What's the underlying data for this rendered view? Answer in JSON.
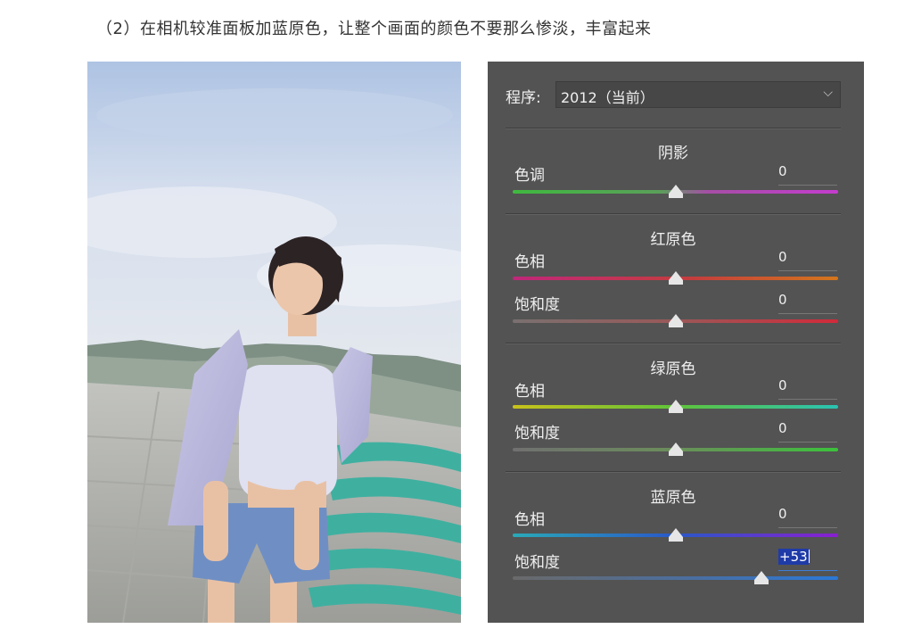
{
  "instruction": "（2）在相机较准面板加蓝原色，让整个画面的颜色不要那么惨淡，丰富起来",
  "colors": {
    "panel_bg": "#535353",
    "highlight": "#1f3ba8"
  },
  "panel": {
    "process_label": "程序:",
    "process_value": "2012（当前）",
    "sections": {
      "shadows": {
        "title": "阴影",
        "tint": {
          "label": "色调",
          "value": "0",
          "slider_fraction": 0.5
        }
      },
      "red": {
        "title": "红原色",
        "hue": {
          "label": "色相",
          "value": "0",
          "slider_fraction": 0.5
        },
        "saturation": {
          "label": "饱和度",
          "value": "0",
          "slider_fraction": 0.5
        }
      },
      "green": {
        "title": "绿原色",
        "hue": {
          "label": "色相",
          "value": "0",
          "slider_fraction": 0.5
        },
        "saturation": {
          "label": "饱和度",
          "value": "0",
          "slider_fraction": 0.5
        }
      },
      "blue": {
        "title": "蓝原色",
        "hue": {
          "label": "色相",
          "value": "0",
          "slider_fraction": 0.5
        },
        "saturation": {
          "label": "饱和度",
          "value": "+53",
          "slider_fraction": 0.765
        }
      }
    }
  }
}
